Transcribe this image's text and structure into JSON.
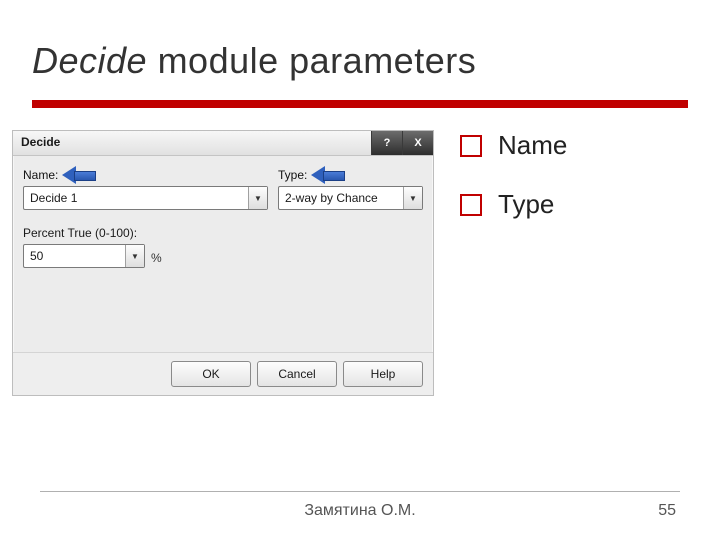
{
  "title": {
    "italic": "Decide",
    "rest": " module parameters"
  },
  "dialog": {
    "caption": "Decide",
    "window_buttons": {
      "help": "?",
      "close": "X"
    },
    "name_label": "Name:",
    "name_value": "Decide 1",
    "type_label": "Type:",
    "type_value": "2-way by Chance",
    "percent_label": "Percent True (0-100):",
    "percent_value": "50",
    "percent_unit": "%",
    "buttons": {
      "ok": "OK",
      "cancel": "Cancel",
      "help": "Help"
    }
  },
  "bullets": [
    "Name",
    "Type"
  ],
  "footer": {
    "author": "Замятина О.М.",
    "page": "55"
  }
}
